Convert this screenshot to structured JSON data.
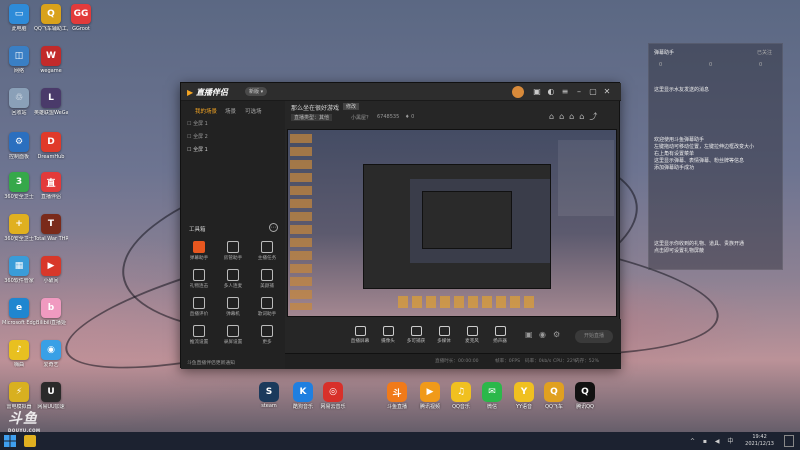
{
  "desktop_icons": [
    {
      "label": "此电脑",
      "color": "#2e8bd8",
      "glyph": "▭"
    },
    {
      "label": "QQ飞车辅助工具",
      "color": "#d9a21b",
      "glyph": "Q"
    },
    {
      "label": "GGroot",
      "color": "#e23b3b",
      "glyph": "GG"
    },
    {
      "label": "网络",
      "color": "#3a7fc4",
      "glyph": "◫"
    },
    {
      "label": "wegame",
      "color": "#c22a2a",
      "glyph": "W"
    },
    {
      "label": "回收站",
      "color": "#8aa0b8",
      "glyph": "♲"
    },
    {
      "label": "英雄联盟WeGame版",
      "color": "#4a3a6a",
      "glyph": "L"
    },
    {
      "label": "控制面板",
      "color": "#2b6fbf",
      "glyph": "⚙"
    },
    {
      "label": "DreamHub",
      "color": "#e03a2a",
      "glyph": "D"
    },
    {
      "label": "360安全卫士",
      "color": "#36a84a",
      "glyph": "3"
    },
    {
      "label": "直播伴侣",
      "color": "#e33a3a",
      "glyph": "直"
    },
    {
      "label": "360安全卫士",
      "color": "#e0b020",
      "glyph": "+"
    },
    {
      "label": "Total War THREE KI...",
      "color": "#7a2a1a",
      "glyph": "T"
    },
    {
      "label": "360软件管家",
      "color": "#3a9cd8",
      "glyph": "▦"
    },
    {
      "label": "小破间",
      "color": "#d8382a",
      "glyph": "▶"
    },
    {
      "label": "Microsoft Edge",
      "color": "#1f86d0",
      "glyph": "e"
    },
    {
      "label": "Bilibili直播姬",
      "color": "#f09ac0",
      "glyph": "b"
    },
    {
      "label": "嗨曲",
      "color": "#e8c020",
      "glyph": "♪"
    },
    {
      "label": "爱奇艺",
      "color": "#39a0e6",
      "glyph": "◉"
    },
    {
      "label": "雷电模拟器",
      "color": "#d8b020",
      "glyph": "⚡"
    },
    {
      "label": "网易UU加速",
      "color": "#2a2a2a",
      "glyph": "U"
    }
  ],
  "right_panel": {
    "title": "弹幕助手",
    "action": "已关注",
    "stats": [
      "0",
      "0",
      "0"
    ],
    "msg1": "这里显示水友发送的消息",
    "msg2": "欢迎使用斗鱼弹幕助手\n左键拖动可移动位置，左键拉伸边框改变大小\n右上角有设置菜单\n这里显示弹幕、表情弹幕、粉丝牌等信息\n添加弹幕助手成功",
    "msg3": "这里显示你收到的礼物、道具、贵族开通\n点击即可设置礼物屏蔽"
  },
  "window": {
    "logo": "直播伴侣",
    "version": "新版 ▾",
    "sidebar_tabs": [
      "我的场景",
      "场景",
      "可选场"
    ],
    "scenes": [
      "☐ 全屏 1",
      "☐ 全屏 2",
      "☐ 全屏 1"
    ],
    "tools_title": "工具箱",
    "tools": [
      "弹幕助手",
      "房管助手",
      "主播任务",
      "礼物连击",
      "多人连麦",
      "美颜捕",
      "直播评价",
      "弹幕机",
      "歌词助手",
      "推流设置",
      "录屏设置",
      "更多"
    ],
    "notice": "斗鱼直播伴侣更新通知",
    "stream_title": "那么坐在很好游戏",
    "stream_tag": "修改",
    "stream_meta": [
      "直播类型：其他",
      "小黑屋？",
      "6748535",
      "♦ 0"
    ],
    "bottom_buttons": [
      "直播屏幕",
      "摄像头",
      "多可捕获",
      "多媒体",
      "麦克风",
      "扬声器"
    ],
    "start_button": "开始直播",
    "status": [
      "直播时长：00:00:00",
      "帧率：0FPS",
      "码率：0kb/s",
      "CPU：22%",
      "内存：52%"
    ]
  },
  "dock": [
    {
      "label": "steam",
      "color": "#1b3a5c",
      "glyph": "S"
    },
    {
      "label": "酷狗音乐",
      "color": "#1f7fe0",
      "glyph": "K"
    },
    {
      "label": "网易云音乐",
      "color": "#d8302a",
      "glyph": "◎"
    },
    {
      "label": "斗鱼直播",
      "color": "#f07a1a",
      "glyph": "斗"
    },
    {
      "label": "腾讯视频",
      "color": "#f09a1a",
      "glyph": "▶"
    },
    {
      "label": "QQ音乐",
      "color": "#f0c020",
      "glyph": "♫"
    },
    {
      "label": "微信",
      "color": "#2bb84a",
      "glyph": "✉"
    },
    {
      "label": "YY语音",
      "color": "#f0c020",
      "glyph": "Y"
    },
    {
      "label": "QQ飞车",
      "color": "#e0a020",
      "glyph": "Q"
    },
    {
      "label": "腾讯QQ",
      "color": "#111",
      "glyph": "Q"
    }
  ],
  "watermark": {
    "text": "斗鱼",
    "sub": "DOUYU.COM"
  },
  "clock": {
    "time": "19:42",
    "date": "2021/12/13"
  }
}
